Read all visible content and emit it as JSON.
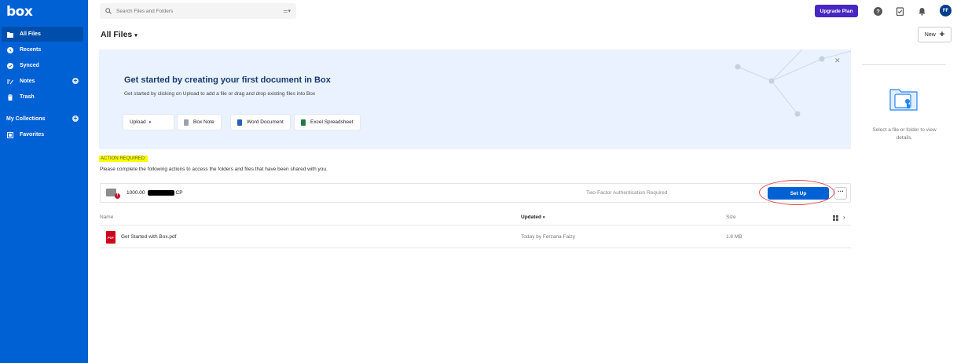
{
  "brand": {
    "logo": "box",
    "accent": "#0061d5",
    "upgrade_color": "#4826c2",
    "alert_color": "#c41230"
  },
  "sidebar": {
    "items": [
      {
        "label": "All Files",
        "icon": "folder-icon",
        "active": true
      },
      {
        "label": "Recents",
        "icon": "clock-icon"
      },
      {
        "label": "Synced",
        "icon": "sync-icon"
      },
      {
        "label": "Notes",
        "icon": "notes-icon"
      },
      {
        "label": "Trash",
        "icon": "trash-icon"
      }
    ],
    "collections_label": "My Collections",
    "favorites_label": "Favorites"
  },
  "header": {
    "search_placeholder": "Search Files and Folders",
    "upgrade_label": "Upgrade Plan",
    "avatar_initials": "FF"
  },
  "main": {
    "title": "All Files",
    "new_label": "New"
  },
  "banner": {
    "title": "Get started by creating your first document in Box",
    "description": "Get started by clicking on Upload to add a file or drag and drop existing files into Box",
    "buttons": {
      "upload": "Upload",
      "box_note": "Box Note",
      "word": "Word Document",
      "excel": "Excel Spreadsheet"
    }
  },
  "action": {
    "label": "ACTION REQUIRED:",
    "text": "Please complete the following actions to access the folders and files that have been shared with you.",
    "item_prefix": "1000.00",
    "item_suffix": "CP",
    "status": "Two-Factor Authentication Required",
    "button": "Set Up",
    "alert_glyph": "!"
  },
  "table": {
    "headers": {
      "name": "Name",
      "updated": "Updated",
      "size": "Size"
    },
    "rows": [
      {
        "name": "Get Started with Box.pdf",
        "updated": "Today by Ferzana Faizy",
        "size": "1.8 MB",
        "badge": "PDF"
      }
    ]
  },
  "right_panel": {
    "text": "Select a file or folder to view details."
  }
}
